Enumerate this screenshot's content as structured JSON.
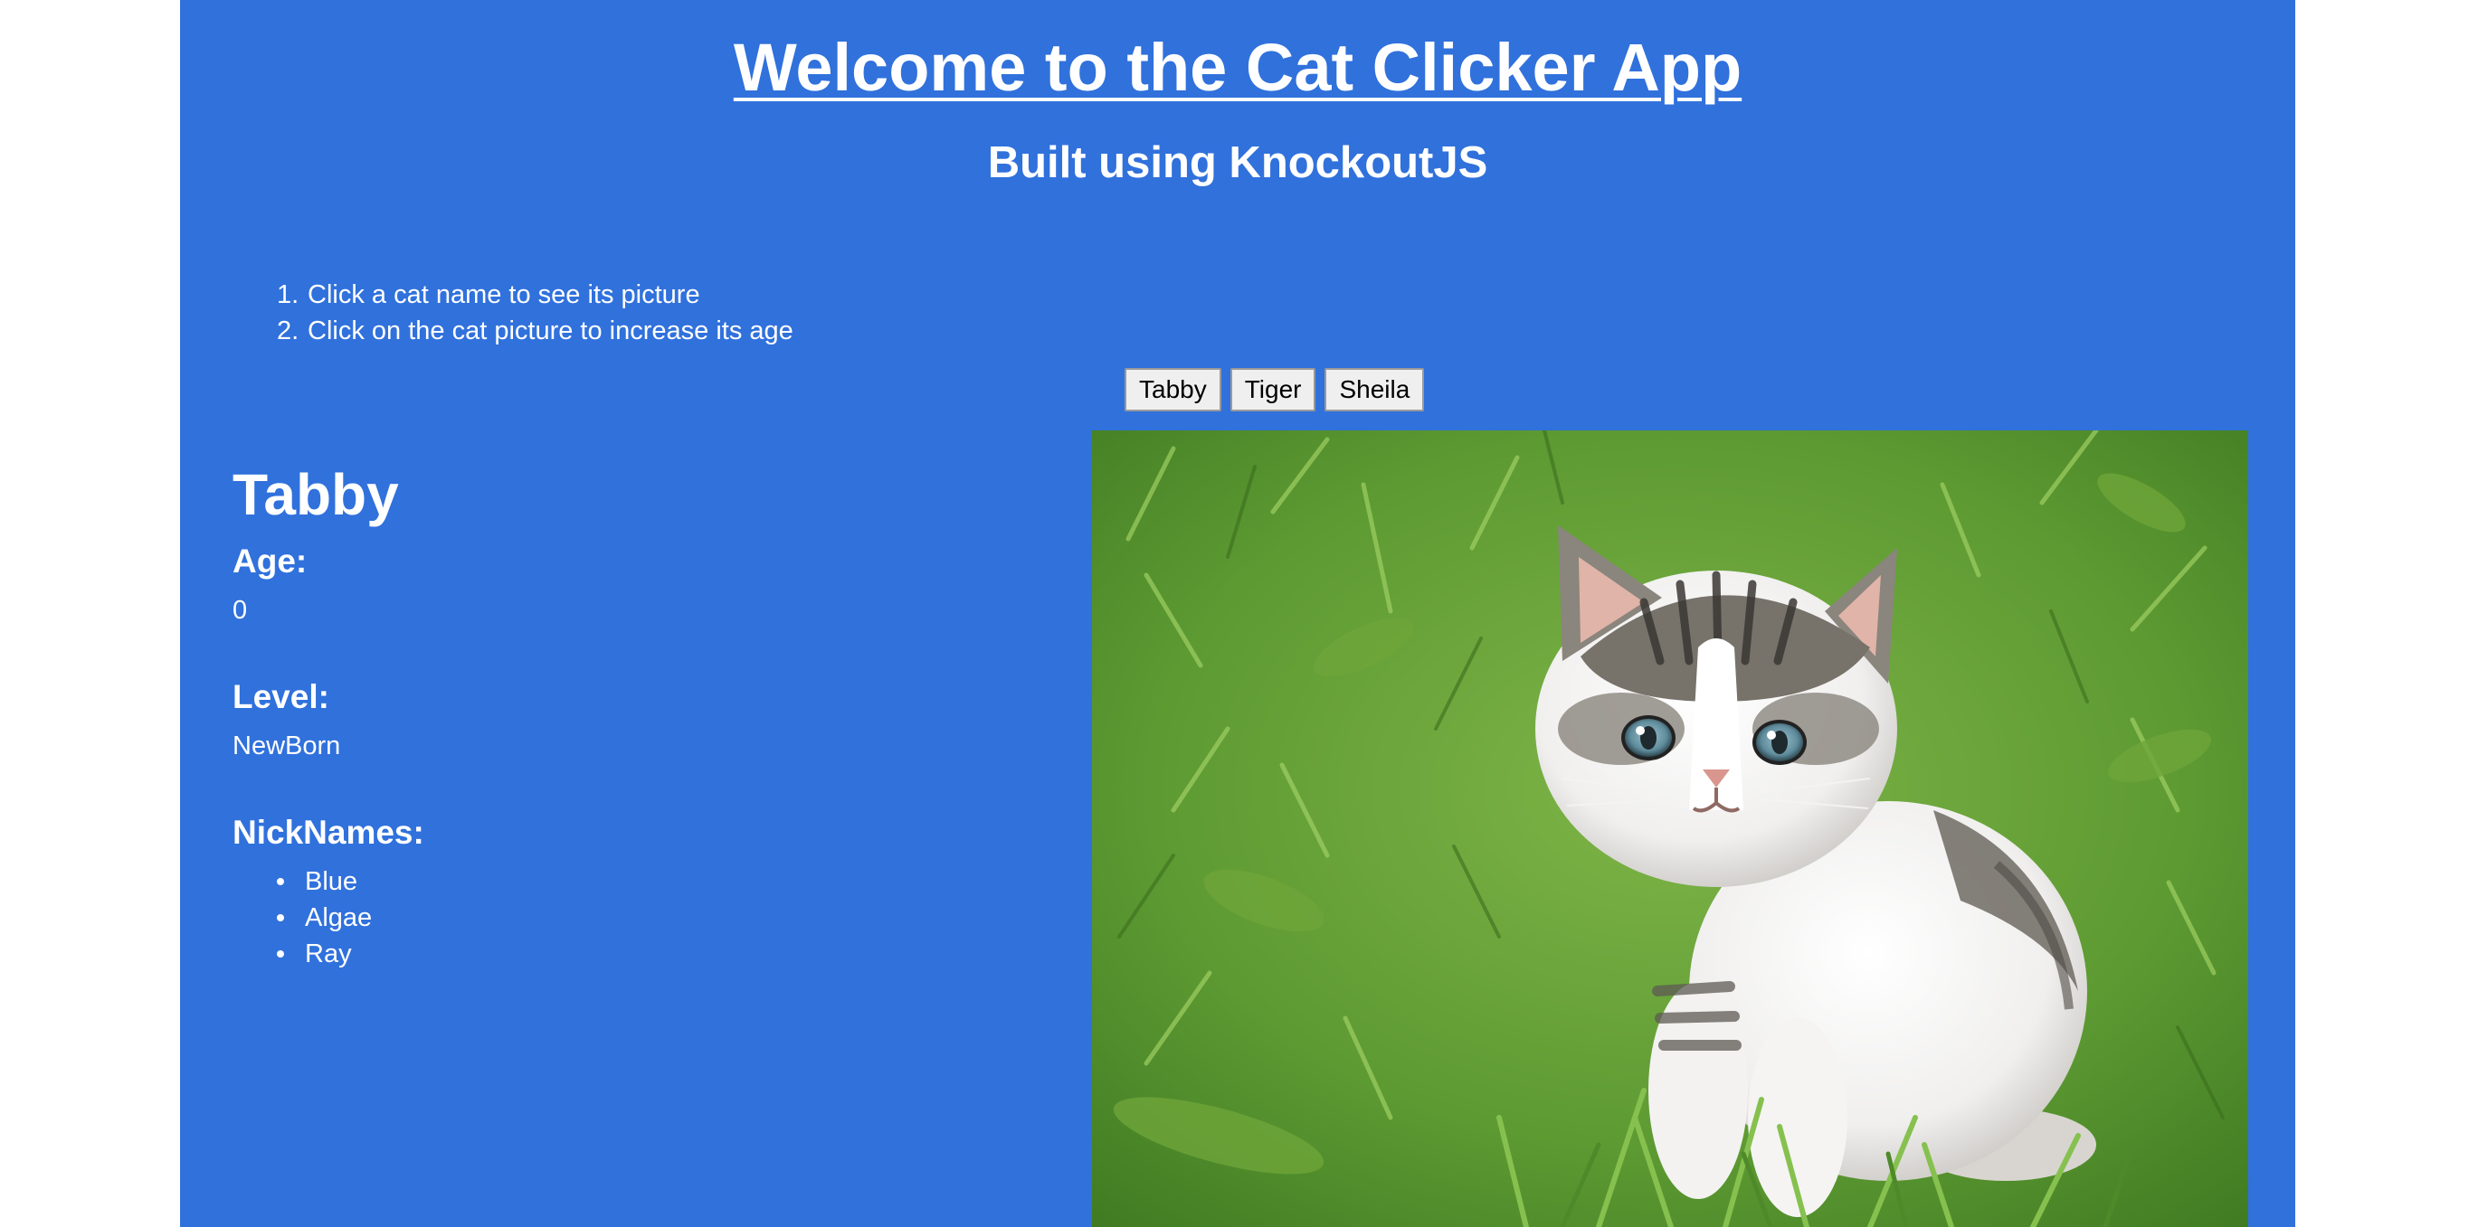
{
  "header": {
    "title": "Welcome to the Cat Clicker App",
    "subtitle": "Built using KnockoutJS"
  },
  "instructions": [
    {
      "number": "1.",
      "text": "Click a cat name to see its picture"
    },
    {
      "number": "2.",
      "text": "Click on the cat picture to increase its age"
    }
  ],
  "cat_buttons": [
    {
      "label": "Tabby"
    },
    {
      "label": "Tiger"
    },
    {
      "label": "Sheila"
    }
  ],
  "current_cat": {
    "name": "Tabby",
    "age_label": "Age:",
    "age": "0",
    "level_label": "Level:",
    "level": "NewBorn",
    "nicknames_label": "NickNames:",
    "nicknames": [
      "Blue",
      "Algae",
      "Ray"
    ],
    "image_subject": "kitten-in-grass"
  },
  "colors": {
    "page_background": "#3071dc",
    "outer_background": "#ffffff",
    "text": "#ffffff",
    "button_background": "#efefef"
  }
}
